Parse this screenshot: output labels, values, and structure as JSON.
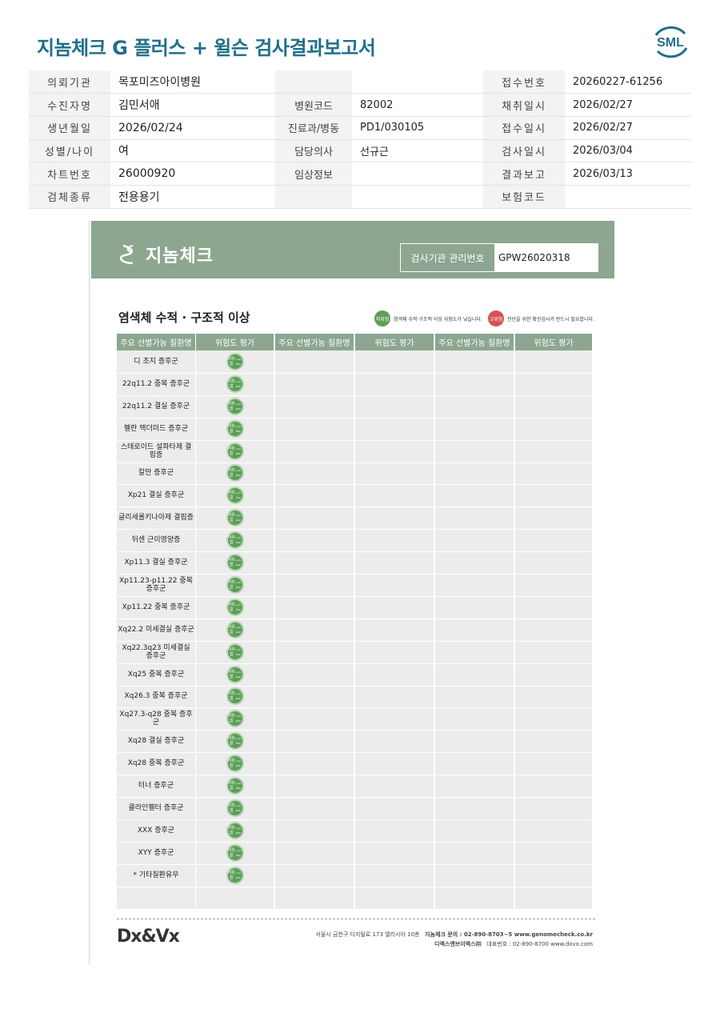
{
  "header": {
    "title": "지놈체크 G 플러스 + 윌슨 검사결과보고서",
    "logo_text": "SML"
  },
  "info": {
    "rows": [
      [
        {
          "label": "의뢰기관",
          "value": "목포미즈아이병원"
        },
        {
          "label": "",
          "value": ""
        },
        {
          "label": "접수번호",
          "value": "20260227-61256"
        }
      ],
      [
        {
          "label": "수진자명",
          "value": "김민서애"
        },
        {
          "label": "병원코드",
          "value": "82002"
        },
        {
          "label": "채취일시",
          "value": "2026/02/27"
        }
      ],
      [
        {
          "label": "생년월일",
          "value": "2026/02/24"
        },
        {
          "label": "진료과/병동",
          "value": "PD1/030105"
        },
        {
          "label": "접수일시",
          "value": "2026/02/27"
        }
      ],
      [
        {
          "label": "성별/나이",
          "value": "여"
        },
        {
          "label": "담당의사",
          "value": "선규근"
        },
        {
          "label": "검사일시",
          "value": "2026/03/04"
        }
      ],
      [
        {
          "label": "차트번호",
          "value": "26000920"
        },
        {
          "label": "임상정보",
          "value": ""
        },
        {
          "label": "결과보고",
          "value": "2026/03/13"
        }
      ],
      [
        {
          "label": "검체종류",
          "value": "전용용기"
        },
        {
          "label": "",
          "value": ""
        },
        {
          "label": "보험코드",
          "value": ""
        }
      ]
    ]
  },
  "scan": {
    "brand": "지놈체크",
    "mgmt_label": "검사기관 관리번호",
    "mgmt_value": "GPW26020318",
    "section_title": "염색체 수적 · 구조적 이상",
    "legend_low_badge": "저위험",
    "legend_low_text": "염색체 수적·구조적 이상 위험도가 낮습니다.",
    "legend_high_badge": "고위험",
    "legend_high_text": "진단을 위한 확진검사가 반드시 필요합니다.",
    "col_disease": "주요 선별가능 질환명",
    "col_risk": "위험도 평가",
    "badge_text": "저위험",
    "badge_sub": "Low Risk",
    "diseases": [
      "디 조지 증후군",
      "22q11.2 중복 증후군",
      "22q11.2 결실 증후군",
      "펠란 맥더미드 증후군",
      "스테로이드 설파타제 결핍증",
      "칼만 증후군",
      "Xp21 결실 증후군",
      "글리세롤키나아제 결핍증",
      "뒤센 근이영양증",
      "Xp11.3 결실 증후군",
      "Xp11.23-p11.22 중복 증후군",
      "Xp11.22 중복 증후군",
      "Xq22.2 미세결실 증후군",
      "Xq22.3q23 미세결실 증후군",
      "Xq25 중복 증후군",
      "Xq26.3 중복 증후군",
      "Xq27.3-q28 중복 증후군",
      "Xq28 결실 증후군",
      "Xq28 중복 증후군",
      "터너 증후군",
      "클라인펠터 증후군",
      "XXX 증후군",
      "XYY 증후군",
      "* 기타질환유무"
    ],
    "footer_logo": "Dx&Vx",
    "footer_address": "서울시 금천구 디지털로 173 엘리시아 10층",
    "footer_inquiry": "지놈체크 문의 : 02-890-8703~5  www.genomecheck.co.kr",
    "footer_company": "디엑스앤브이엑스㈜",
    "footer_phone": "대표번호 : 02-890-8700  www.dxvx.com"
  },
  "colors": {
    "title": "#1f6f8b",
    "scan_green": "#8ca690",
    "badge_green": "#5d9e58",
    "badge_red": "#d9534f"
  }
}
